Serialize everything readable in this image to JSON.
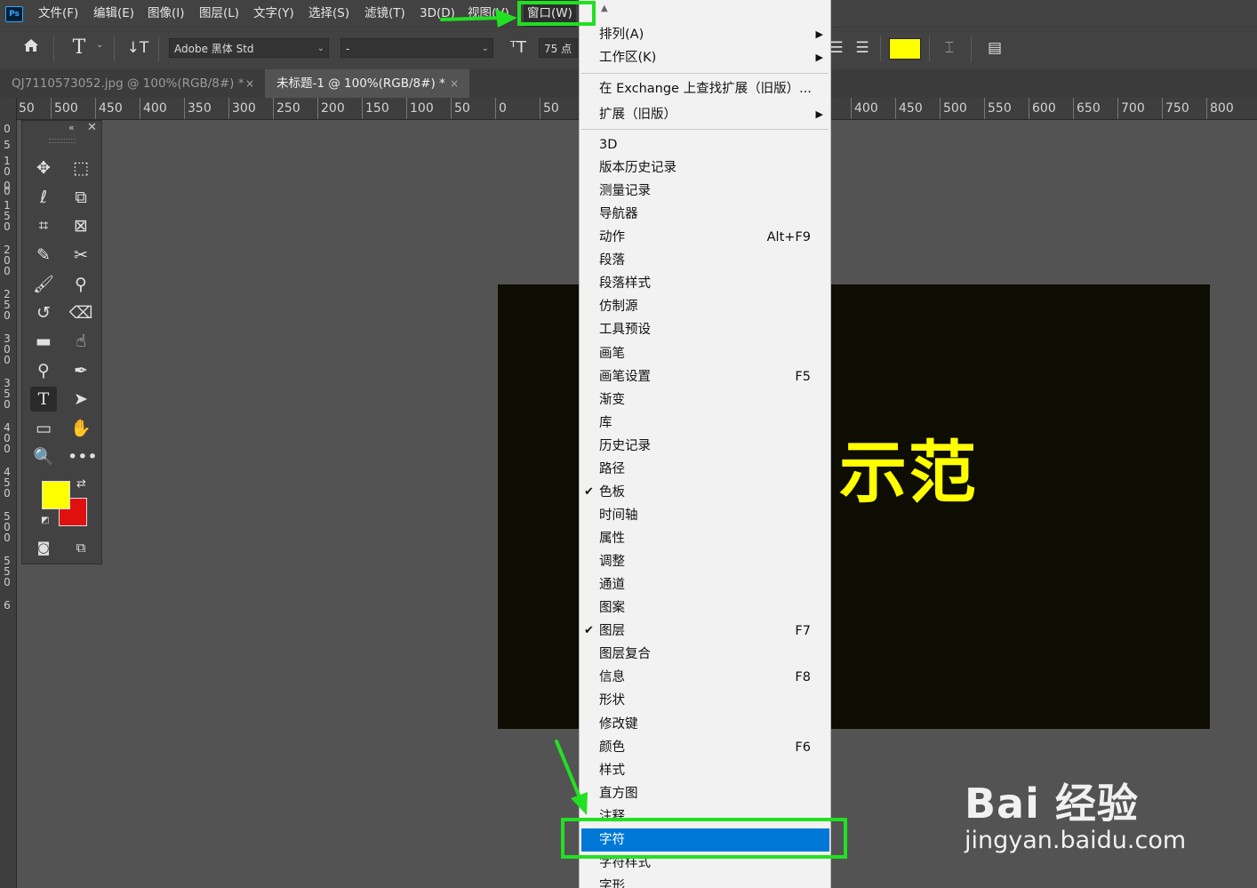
{
  "app": {
    "logo": "Ps"
  },
  "menubar": {
    "items": [
      "文件(F)",
      "编辑(E)",
      "图像(I)",
      "图层(L)",
      "文字(Y)",
      "选择(S)",
      "滤镜(T)",
      "3D(D)",
      "视图(V)",
      "窗口(W)"
    ]
  },
  "options": {
    "font_family": "Adobe 黑体 Std",
    "font_style": "-",
    "font_size": "75 点",
    "text_color": "#ffff00"
  },
  "tabs": [
    {
      "label": "QJ7110573052.jpg @ 100%(RGB/8#) *",
      "active": false,
      "close": "×"
    },
    {
      "label": "未标题-1 @ 100%(RGB/8#) *",
      "active": true,
      "close": "×"
    }
  ],
  "ruler": {
    "h_labels": [
      "50",
      "500",
      "450",
      "400",
      "350",
      "300",
      "250",
      "200",
      "150",
      "100",
      "50",
      "0",
      "50",
      "400",
      "450",
      "500",
      "550",
      "600",
      "650",
      "700",
      "750",
      "800"
    ],
    "v_labels": [
      "0",
      "5",
      "0",
      "1",
      "0",
      "0",
      "1",
      "5",
      "0",
      "2",
      "0",
      "0",
      "2",
      "5",
      "0",
      "3",
      "0",
      "0",
      "3",
      "5",
      "0",
      "4",
      "0",
      "0",
      "4",
      "5",
      "0",
      "5",
      "0",
      "0",
      "5",
      "5",
      "0",
      "6"
    ]
  },
  "toolbar": {
    "foreground_color": "#ffff00",
    "background_color": "#e01010"
  },
  "canvas": {
    "text": "示范",
    "text_color": "#ffff00",
    "background": "#0d0d03"
  },
  "window_menu": {
    "group1": [
      {
        "label": "排列(A)",
        "submenu": true
      },
      {
        "label": "工作区(K)",
        "submenu": true
      }
    ],
    "group2": [
      {
        "label": "在 Exchange 上查找扩展（旧版）..."
      },
      {
        "label": "扩展（旧版）",
        "submenu": true
      }
    ],
    "group3": [
      {
        "label": "3D"
      },
      {
        "label": "版本历史记录"
      },
      {
        "label": "测量记录"
      },
      {
        "label": "导航器"
      },
      {
        "label": "动作",
        "shortcut": "Alt+F9"
      },
      {
        "label": "段落"
      },
      {
        "label": "段落样式"
      },
      {
        "label": "仿制源"
      },
      {
        "label": "工具预设"
      },
      {
        "label": "画笔"
      },
      {
        "label": "画笔设置",
        "shortcut": "F5"
      },
      {
        "label": "渐变"
      },
      {
        "label": "库"
      },
      {
        "label": "历史记录"
      },
      {
        "label": "路径"
      },
      {
        "label": "色板",
        "checked": true
      },
      {
        "label": "时间轴"
      },
      {
        "label": "属性"
      },
      {
        "label": "调整"
      },
      {
        "label": "通道"
      },
      {
        "label": "图案"
      },
      {
        "label": "图层",
        "shortcut": "F7",
        "checked": true
      },
      {
        "label": "图层复合"
      },
      {
        "label": "信息",
        "shortcut": "F8"
      },
      {
        "label": "形状"
      },
      {
        "label": "修改键"
      },
      {
        "label": "颜色",
        "shortcut": "F6"
      },
      {
        "label": "样式"
      },
      {
        "label": "直方图"
      },
      {
        "label": "注释"
      },
      {
        "label": "字符",
        "highlighted": true
      },
      {
        "label": "字符样式"
      },
      {
        "label": "字形"
      }
    ],
    "check_mark": "✔",
    "submenu_arrow": "▶",
    "scroll_up_arrow": "▲"
  },
  "annotation": {
    "color": "#22e022"
  },
  "watermark": {
    "logo": "Bai 经验",
    "url": "jingyan.baidu.com"
  }
}
